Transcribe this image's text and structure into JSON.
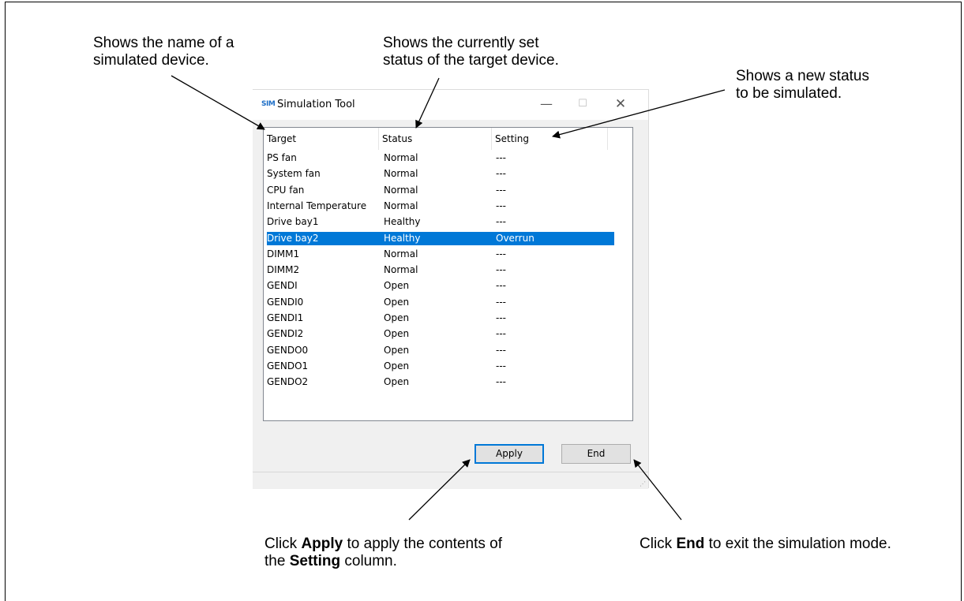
{
  "callouts": {
    "name": [
      "Shows the name of a",
      "simulated device."
    ],
    "status": [
      "Shows the currently set",
      "status of the target device."
    ],
    "setting": [
      "Shows a new status",
      "to be simulated."
    ],
    "apply": {
      "pre": "Click ",
      "bold1": "Apply",
      "mid": " to apply the contents of",
      "pre2": "the ",
      "bold2": "Setting",
      "post": " column."
    },
    "end": {
      "pre": "Click ",
      "bold": "End",
      "post": " to exit the simulation mode."
    }
  },
  "window": {
    "icon_text": "SIM",
    "title": "Simulation Tool",
    "minimize": "—",
    "maximize": "☐",
    "close": "✕"
  },
  "table": {
    "headers": [
      "Target",
      "Status",
      "Setting"
    ],
    "rows": [
      {
        "target": "PS fan",
        "status": "Normal",
        "setting": "---"
      },
      {
        "target": "System fan",
        "status": "Normal",
        "setting": "---"
      },
      {
        "target": "CPU fan",
        "status": "Normal",
        "setting": "---"
      },
      {
        "target": "Internal Temperature",
        "status": "Normal",
        "setting": "---"
      },
      {
        "target": "Drive bay1",
        "status": "Healthy",
        "setting": "---"
      },
      {
        "target": "Drive bay2",
        "status": "Healthy",
        "setting": "Overrun",
        "selected": true
      },
      {
        "target": "DIMM1",
        "status": "Normal",
        "setting": "---"
      },
      {
        "target": "DIMM2",
        "status": "Normal",
        "setting": "---"
      },
      {
        "target": "GENDI",
        "status": "Open",
        "setting": "---"
      },
      {
        "target": "GENDI0",
        "status": "Open",
        "setting": "---"
      },
      {
        "target": "GENDI1",
        "status": "Open",
        "setting": "---"
      },
      {
        "target": "GENDI2",
        "status": "Open",
        "setting": "---"
      },
      {
        "target": "GENDO0",
        "status": "Open",
        "setting": "---"
      },
      {
        "target": "GENDO1",
        "status": "Open",
        "setting": "---"
      },
      {
        "target": "GENDO2",
        "status": "Open",
        "setting": "---"
      }
    ]
  },
  "buttons": {
    "apply": "Apply",
    "end": "End"
  },
  "colors": {
    "selection": "#0078d7",
    "focus_border": "#0078d7"
  }
}
